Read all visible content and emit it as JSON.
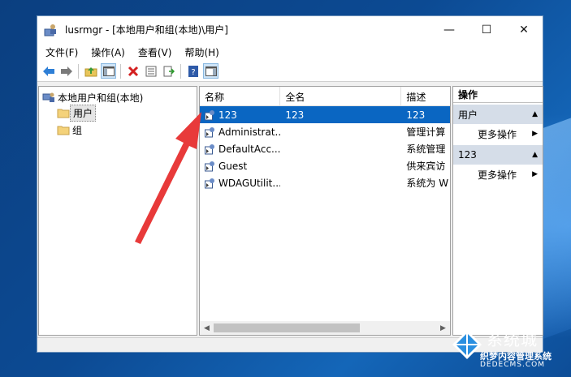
{
  "window": {
    "title": "lusrmgr - [本地用户和组(本地)\\用户]"
  },
  "window_controls": {
    "minimize": "—",
    "maximize": "☐",
    "close": "✕"
  },
  "menu": [
    "文件(F)",
    "操作(A)",
    "查看(V)",
    "帮助(H)"
  ],
  "tree": {
    "root": "本地用户和组(本地)",
    "users": "用户",
    "groups": "组"
  },
  "list": {
    "columns": [
      "名称",
      "全名",
      "描述"
    ],
    "rows": [
      {
        "name": "123",
        "full_name": "123",
        "description": "123"
      },
      {
        "name": "Administrat...",
        "full_name": "",
        "description": "管理计算"
      },
      {
        "name": "DefaultAcc...",
        "full_name": "",
        "description": "系统管理"
      },
      {
        "name": "Guest",
        "full_name": "",
        "description": "供来宾访"
      },
      {
        "name": "WDAGUtilit...",
        "full_name": "",
        "description": "系统为 W"
      }
    ]
  },
  "actions": {
    "title": "操作",
    "section1": "用户",
    "section1_more": "更多操作",
    "section2": "123",
    "section2_more": "更多操作"
  },
  "watermark": {
    "brand": "系统城",
    "sub": "织梦内容管理系统",
    "url": "DEDECMS.COM"
  },
  "colors": {
    "selection": "#0a66c2",
    "arrow": "#e83a3a",
    "desktop": "#0c4a93"
  }
}
